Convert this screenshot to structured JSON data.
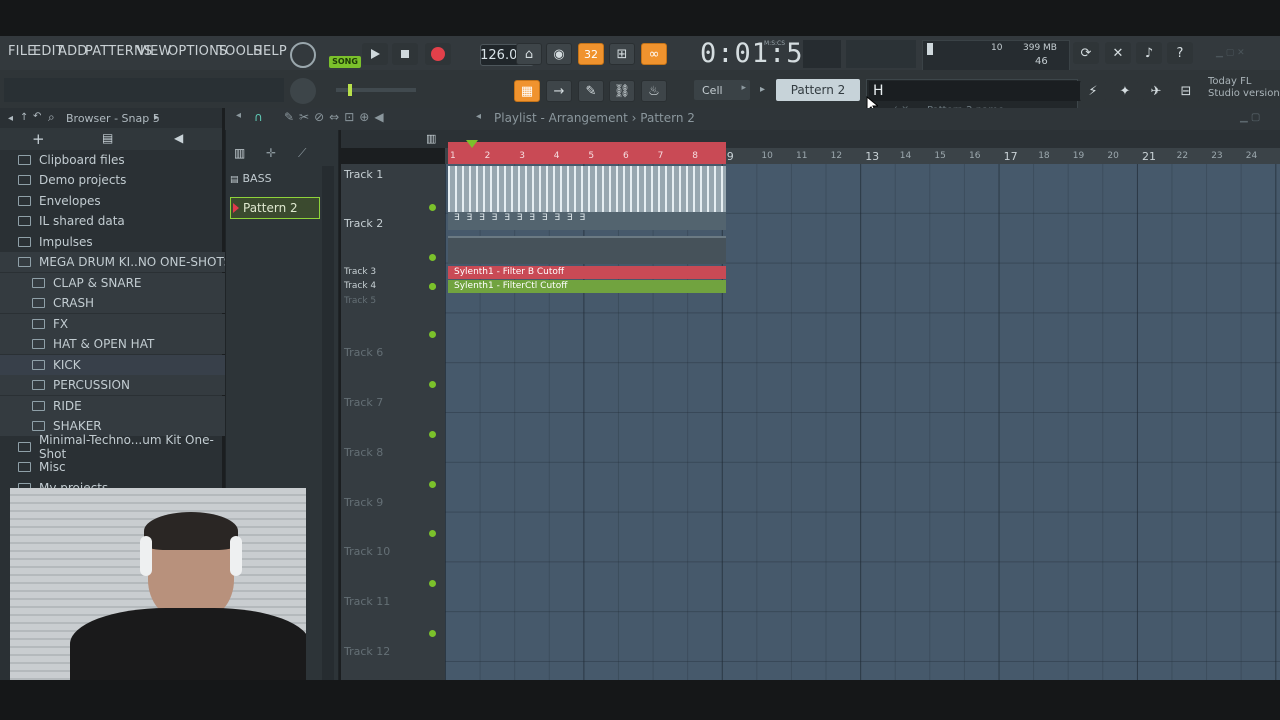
{
  "menu": [
    "FILE",
    "EDIT",
    "ADD",
    "PATTERNS",
    "VIEW",
    "OPTIONS",
    "TOOLS",
    "HELP"
  ],
  "transport": {
    "song_label": "SONG",
    "play_icon": "play-icon",
    "stop_icon": "stop-icon",
    "record_icon": "record-icon",
    "tempo": "126.000",
    "time": "0:01:52",
    "time_unit": "M:S:CS",
    "step_label": "32"
  },
  "meter": {
    "cpu": "10",
    "memory": "399 MB",
    "polyphony": "46"
  },
  "snap": {
    "label": "Cell"
  },
  "pattern": {
    "current": "Pattern 2",
    "rename_value": "H",
    "rename_hint": "Pattern 2 name"
  },
  "news": {
    "line1": "Today  FL",
    "line2": "Studio version"
  },
  "browser": {
    "title": "Browser - Snap 5",
    "items": [
      {
        "label": "Clipboard files",
        "level": 0
      },
      {
        "label": "Demo projects",
        "level": 0
      },
      {
        "label": "Envelopes",
        "level": 0
      },
      {
        "label": "IL shared data",
        "level": 0
      },
      {
        "label": "Impulses",
        "level": 0
      },
      {
        "label": "MEGA DRUM KI..NO ONE-SHOTS",
        "level": 0,
        "open": true
      },
      {
        "label": "CLAP & SNARE",
        "level": 1
      },
      {
        "label": "CRASH",
        "level": 1
      },
      {
        "label": "FX",
        "level": 1
      },
      {
        "label": "HAT & OPEN HAT",
        "level": 1
      },
      {
        "label": "KICK",
        "level": 1,
        "selected": true
      },
      {
        "label": "PERCUSSION",
        "level": 1
      },
      {
        "label": "RIDE",
        "level": 1
      },
      {
        "label": "SHAKER",
        "level": 1
      },
      {
        "label": "Minimal-Techno...um Kit One-Shot",
        "level": 0
      },
      {
        "label": "Misc",
        "level": 0
      },
      {
        "label": "My projects",
        "level": 0
      }
    ]
  },
  "picker": {
    "group": "BASS",
    "pattern": "Pattern 2"
  },
  "playlist": {
    "title": "Playlist - Arrangement",
    "pattern": "Pattern 2",
    "bars": [
      "1",
      "2",
      "3",
      "4",
      "5",
      "6",
      "7",
      "8",
      "9",
      "10",
      "11",
      "12",
      "13",
      "14",
      "15",
      "16",
      "17",
      "18",
      "19",
      "20",
      "21",
      "22",
      "23",
      "24"
    ],
    "tracks": [
      "Track 1",
      "Track 2",
      "Track 3",
      "Track 4",
      "Track 5",
      "Track 6",
      "Track 7",
      "Track 8",
      "Track 9",
      "Track 10",
      "Track 11",
      "Track 12"
    ],
    "clips": {
      "filter_b": "Sylenth1 - Filter B Cutoff",
      "filterctl": "Sylenth1 - FilterCtl Cutoff"
    }
  }
}
